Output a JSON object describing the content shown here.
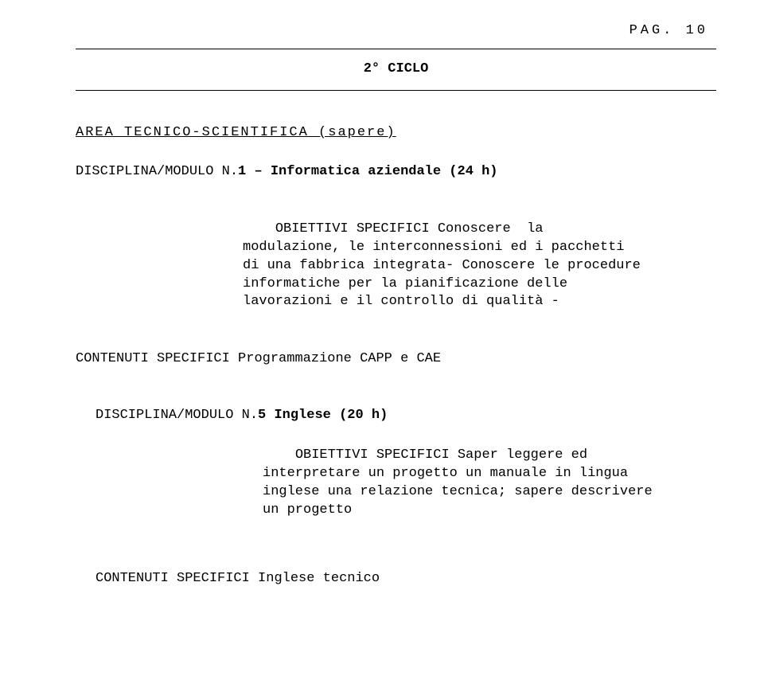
{
  "page_number_label": "PAG. 10",
  "cycle_heading": "2° CICLO",
  "area_title": "AREA TECNICO-SCIENTIFICA (sapere)",
  "module1": {
    "label_prefix": "DISCIPLINA/MODULO N.",
    "label_bold": "1 – Informatica aziendale (24 h)",
    "objectives_label": "OBIETTIVI SPECIFICI",
    "objectives_text": "Conoscere  la modulazione, le interconnessioni ed i pacchetti di una fabbrica integrata- Conoscere le procedure informatiche per la pianificazione delle lavorazioni e il controllo di qualità -",
    "content_label": "CONTENUTI SPECIFICI",
    "content_text": "Programmazione CAPP e CAE"
  },
  "module5": {
    "label_prefix": "DISCIPLINA/MODULO N.",
    "label_bold": "5  Inglese (20 h)",
    "objectives_label": "OBIETTIVI SPECIFICI",
    "objectives_text": "Saper leggere ed interpretare un progetto un manuale in lingua inglese una relazione tecnica; sapere descrivere un progetto",
    "content_label": "CONTENUTI SPECIFICI",
    "content_text": "Inglese tecnico"
  }
}
